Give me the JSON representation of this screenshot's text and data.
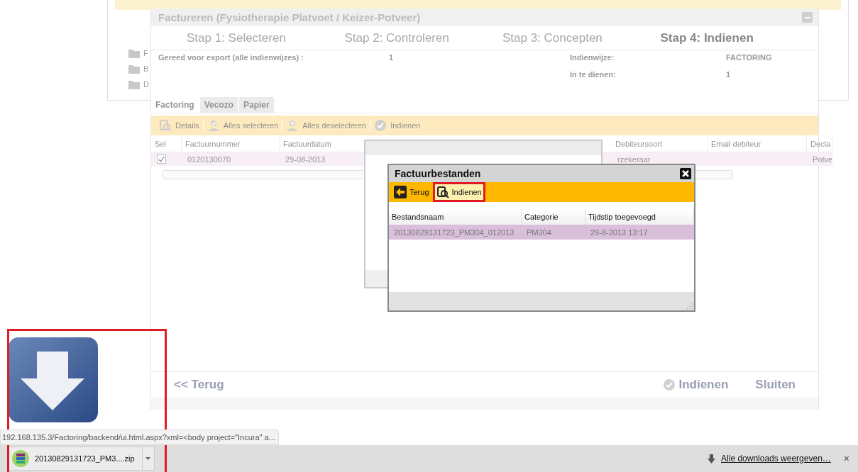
{
  "background_panel": {
    "items": [
      {
        "label": "F"
      },
      {
        "label": "B"
      },
      {
        "label": "D"
      }
    ]
  },
  "dialog": {
    "title": "Factureren (Fysiotherapie Platvoet / Keizer-Potveer)",
    "steps": [
      {
        "label": "Stap 1: Selecteren",
        "selected": false
      },
      {
        "label": "Stap 2: Controleren",
        "selected": false
      },
      {
        "label": "Stap 3: Concepten",
        "selected": false
      },
      {
        "label": "Stap 4: Indienen",
        "selected": true
      }
    ],
    "info_left": [
      {
        "label": "Gereed voor export (alle indienwijzes) :",
        "value": "1"
      }
    ],
    "info_right": [
      {
        "label": "Indienwijze:",
        "value": "FACTORING"
      },
      {
        "label": "In te dienen:",
        "value": "1"
      }
    ],
    "tabs": [
      {
        "label": "Factoring",
        "selected": true
      },
      {
        "label": "Vecozo",
        "selected": false
      },
      {
        "label": "Papier",
        "selected": false
      }
    ],
    "toolbar": [
      {
        "label": "Details",
        "kind": "details"
      },
      {
        "label": "Alles selecteren",
        "kind": "select"
      },
      {
        "label": "Alles deselecteren",
        "kind": "deselect"
      },
      {
        "label": "Indienen",
        "kind": "submit"
      }
    ],
    "table": {
      "columns": [
        "Sel",
        "Factuurnummer",
        "Factuurdatum",
        "Debiteursoort",
        "Email debiteur",
        "Decla"
      ],
      "rows": [
        {
          "checked": true,
          "factuurnummer": "0120130070",
          "factuurdatum": "29-08-2013",
          "debiteursoort": "rzekeraar",
          "decla": "Potve"
        }
      ]
    },
    "footer": {
      "back": "<< Terug",
      "submit": "Indienen",
      "close": "Sluiten"
    }
  },
  "files_dialog": {
    "title": "Factuurbestanden",
    "toolbar": [
      {
        "label": "Terug",
        "kind": "back",
        "highlighted": false
      },
      {
        "label": "Indienen",
        "kind": "submit",
        "highlighted": true
      }
    ],
    "columns": [
      "Bestandsnaam",
      "Categorie",
      "Tijdstip toegevoegd"
    ],
    "rows": [
      {
        "selected": true,
        "cells": [
          "20130829131723_PM304_012013",
          "PM304",
          "29-8-2013 13:17"
        ]
      }
    ]
  },
  "status_url": "192.168.135.3/Factoring/backend/ui.html.aspx?xml=<body project=\"Incura\" a...",
  "download_bar": {
    "item": "20130829131723_PM3....zip",
    "show_all": "Alle downloads weergeven…",
    "close": "×"
  }
}
